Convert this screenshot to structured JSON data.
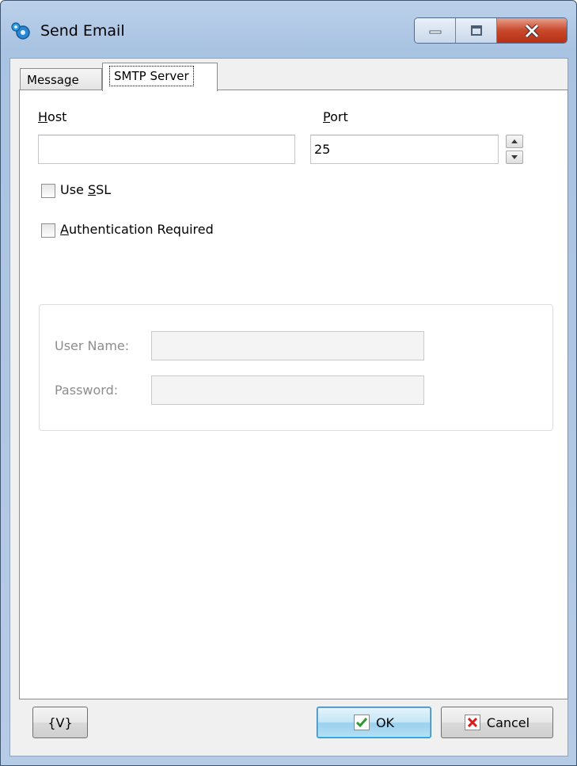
{
  "window": {
    "title": "Send Email"
  },
  "tabs": [
    {
      "label_pre": "Messa",
      "label_key": "g",
      "label_post": "e"
    },
    {
      "label": "SMTP Server"
    }
  ],
  "smtp": {
    "host_key": "H",
    "host_rest": "ost",
    "host_value": "",
    "port_key": "P",
    "port_rest": "ort",
    "port_value": "25",
    "ssl_pre": "Use ",
    "ssl_key": "S",
    "ssl_post": "SL",
    "auth_key": "A",
    "auth_rest": "uthentication Required",
    "username_label": "User Name:",
    "username_value": "",
    "password_label": "Password:",
    "password_value": ""
  },
  "footer": {
    "vars_label": "{V}",
    "ok_label": "OK",
    "cancel_label": "Cancel"
  },
  "icons": {
    "ok": "check-icon",
    "cancel": "x-icon",
    "app": "gears-icon"
  },
  "colors": {
    "ok_check": "#2e9a2e",
    "cancel_x": "#d42020",
    "close_button": "#c8472b"
  }
}
